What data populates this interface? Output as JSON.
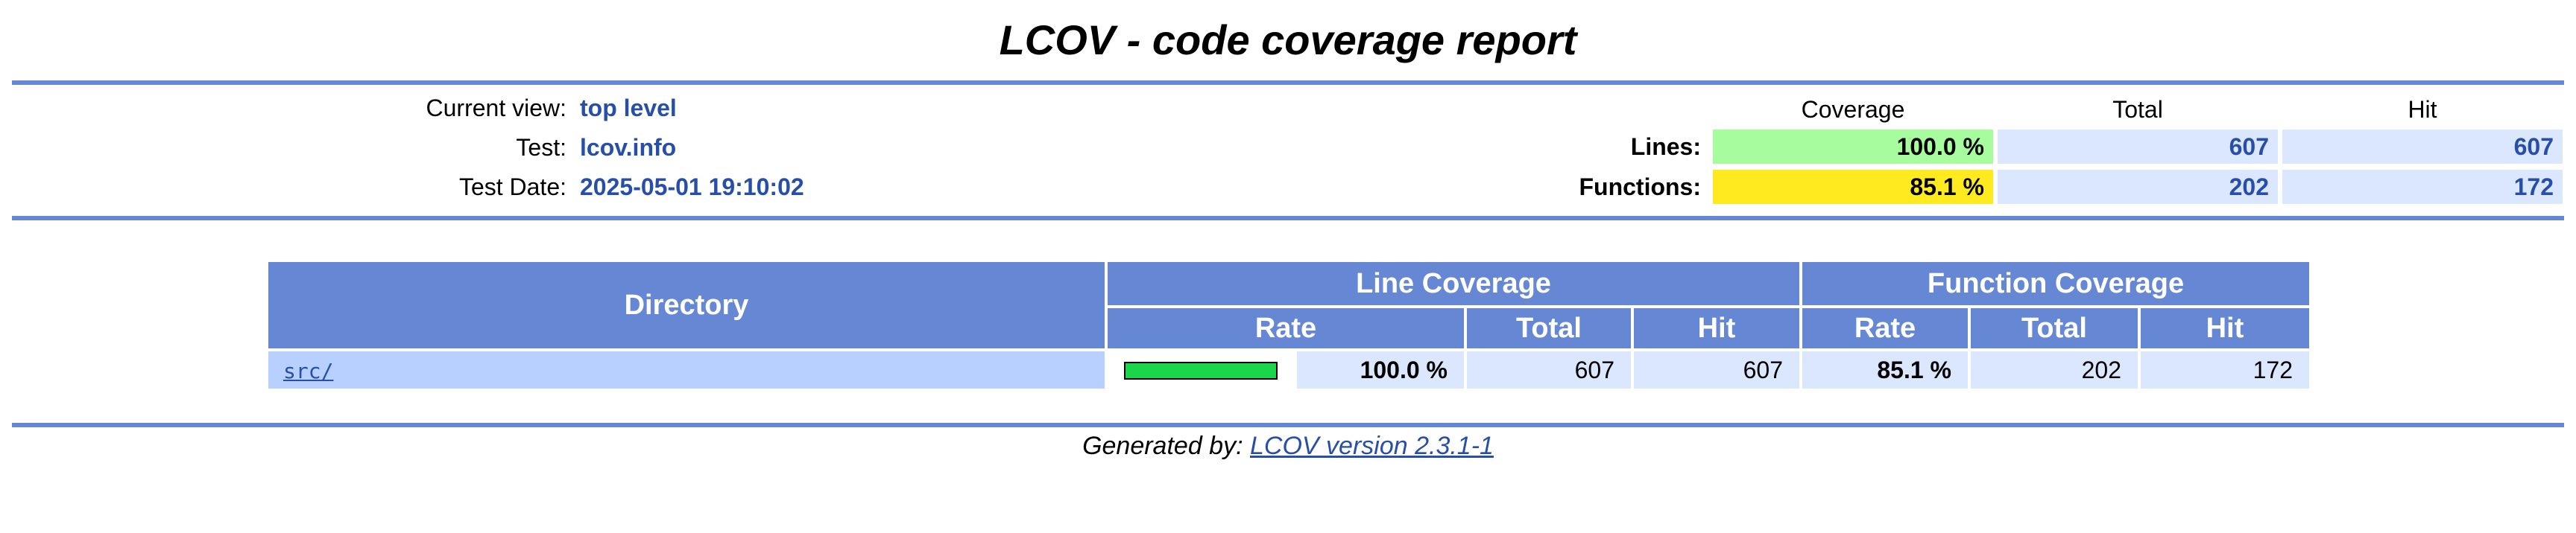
{
  "header": {
    "title": "LCOV - code coverage report"
  },
  "info": {
    "current_view_label": "Current view:",
    "current_view_value": "top level",
    "test_label": "Test:",
    "test_value": "lcov.info",
    "test_date_label": "Test Date:",
    "test_date_value": "2025-05-01 19:10:02"
  },
  "summary": {
    "headers": [
      "Coverage",
      "Total",
      "Hit"
    ],
    "lines": {
      "label": "Lines:",
      "coverage": "100.0 %",
      "total": "607",
      "hit": "607"
    },
    "functions": {
      "label": "Functions:",
      "coverage": "85.1 %",
      "total": "202",
      "hit": "172"
    }
  },
  "table": {
    "directory_header": "Directory",
    "line_coverage_header": "Line Coverage",
    "function_coverage_header": "Function Coverage",
    "sub_headers": [
      "Rate",
      "Total",
      "Hit",
      "Rate",
      "Total",
      "Hit"
    ],
    "rows": [
      {
        "directory": "src/",
        "line_bar_fraction": 1.0,
        "line_rate": "100.0 %",
        "line_total": "607",
        "line_hit": "607",
        "func_rate": "85.1 %",
        "func_total": "202",
        "func_hit": "172"
      }
    ]
  },
  "footer": {
    "generated_by": "Generated by:",
    "link_text": "LCOV version 2.3.1-1"
  },
  "colors": {
    "rule": "#6688d4",
    "header_bg": "#6688d4",
    "high_coverage": "#a7fc9d",
    "medium_coverage": "#ffea20",
    "bar_fill": "#1bd64a",
    "link": "#284fa8"
  }
}
